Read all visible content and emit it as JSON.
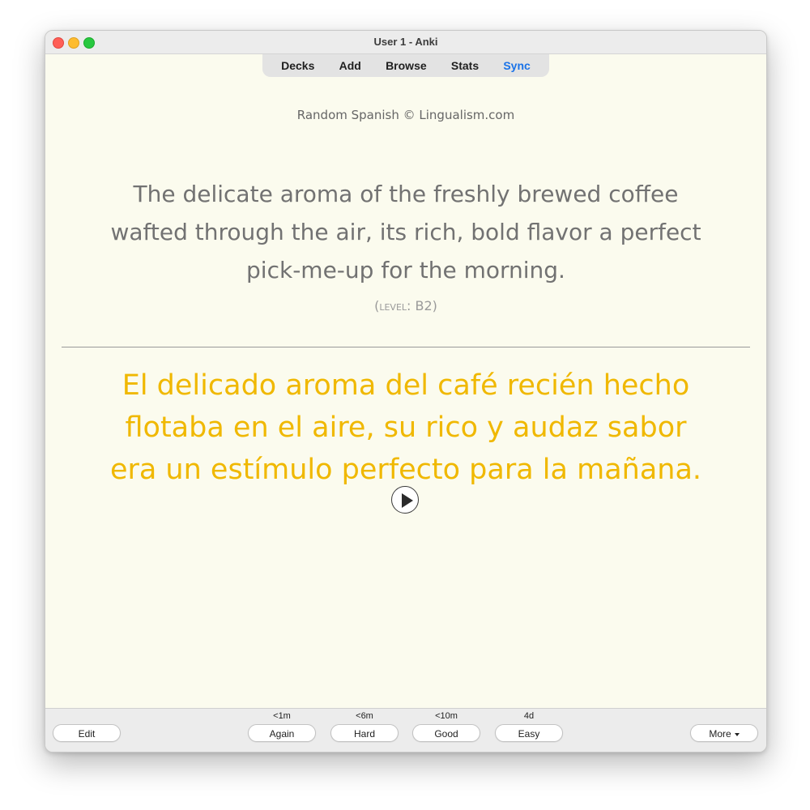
{
  "window": {
    "title": "User 1 - Anki"
  },
  "toolbar": {
    "decks": "Decks",
    "add": "Add",
    "browse": "Browse",
    "stats": "Stats",
    "sync": "Sync"
  },
  "card": {
    "attribution": "Random Spanish © Lingualism.com",
    "english_lines": [
      "The delicate aroma of the freshly brewed coffee",
      "wafted through the air, its rich, bold flavor a perfect",
      "pick-me-up for the morning."
    ],
    "level": "(level: B2)",
    "spanish_lines": [
      "El delicado aroma del café recién hecho",
      "flotaba en el aire, su rico y audaz sabor",
      "era un estímulo perfecto para la mañana."
    ],
    "play_icon": "play-icon"
  },
  "bottom": {
    "edit": "Edit",
    "answers": [
      {
        "label": "Again",
        "due": "<1m"
      },
      {
        "label": "Hard",
        "due": "<6m"
      },
      {
        "label": "Good",
        "due": "<10m"
      },
      {
        "label": "Easy",
        "due": "4d"
      }
    ],
    "more": "More"
  },
  "colors": {
    "card_background": "#fbfbee",
    "english_text": "#727272",
    "spanish_text": "#f0b800",
    "sync_accent": "#1a73e8"
  }
}
